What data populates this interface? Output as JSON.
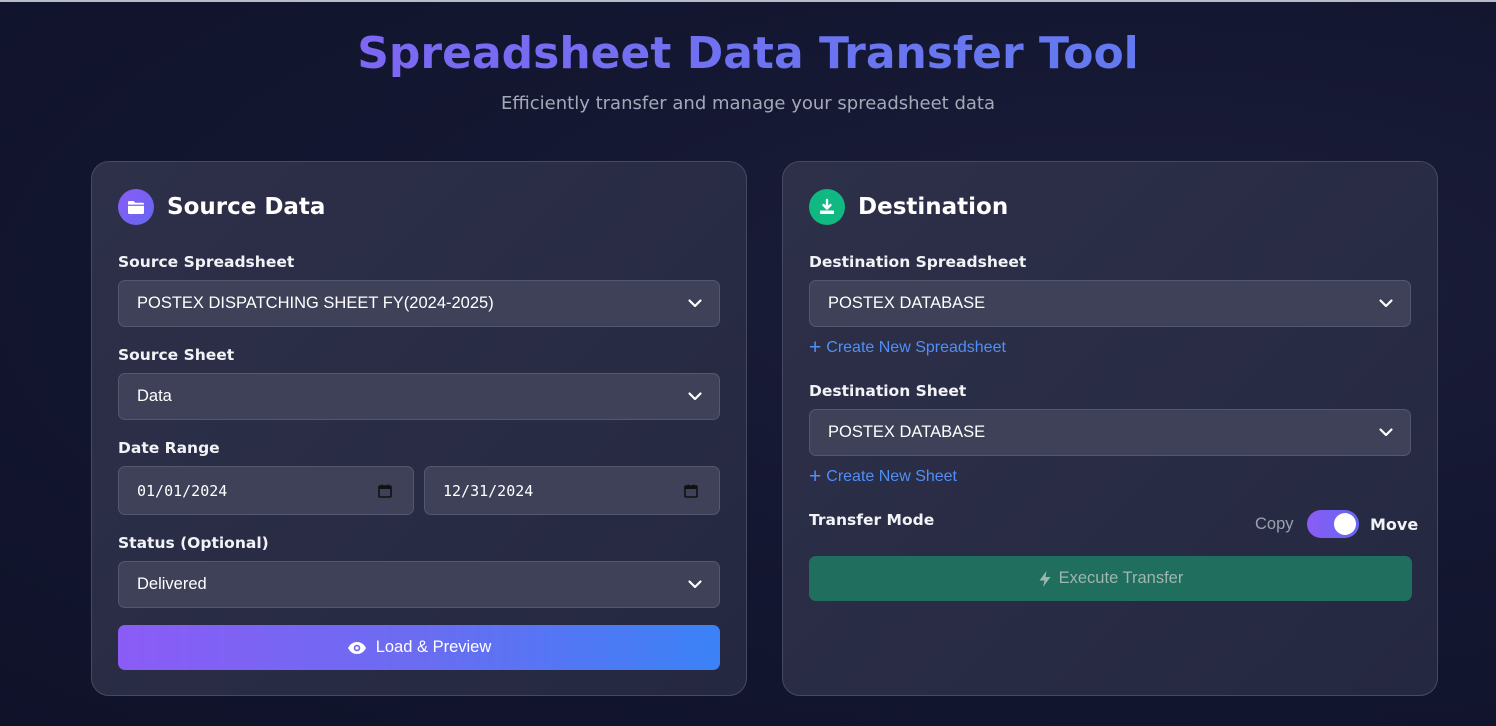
{
  "header": {
    "title": "Spreadsheet Data Transfer Tool",
    "subtitle": "Efficiently transfer and manage your spreadsheet data"
  },
  "source": {
    "title": "Source Data",
    "icon": "folder-icon",
    "spreadsheet_label": "Source Spreadsheet",
    "spreadsheet_value": "POSTEX DISPATCHING SHEET FY(2024-2025)",
    "sheet_label": "Source Sheet",
    "sheet_value": "Data",
    "date_range_label": "Date Range",
    "date_from": "01/01/2024",
    "date_to": "12/31/2024",
    "status_label": "Status (Optional)",
    "status_value": "Delivered",
    "load_button": "Load & Preview"
  },
  "destination": {
    "title": "Destination",
    "icon": "download-icon",
    "spreadsheet_label": "Destination Spreadsheet",
    "spreadsheet_value": "POSTEX DATABASE",
    "create_spreadsheet": "Create New Spreadsheet",
    "sheet_label": "Destination Sheet",
    "sheet_value": "POSTEX DATABASE",
    "create_sheet": "Create New Sheet",
    "mode_label": "Transfer Mode",
    "mode_copy": "Copy",
    "mode_move": "Move",
    "mode_selected": "Move",
    "execute_button": "Execute Transfer"
  },
  "colors": {
    "accent_purple": "#8b5cf6",
    "accent_blue": "#3b82f6",
    "success_green": "#10b981",
    "link_blue": "#4f8ff7"
  }
}
